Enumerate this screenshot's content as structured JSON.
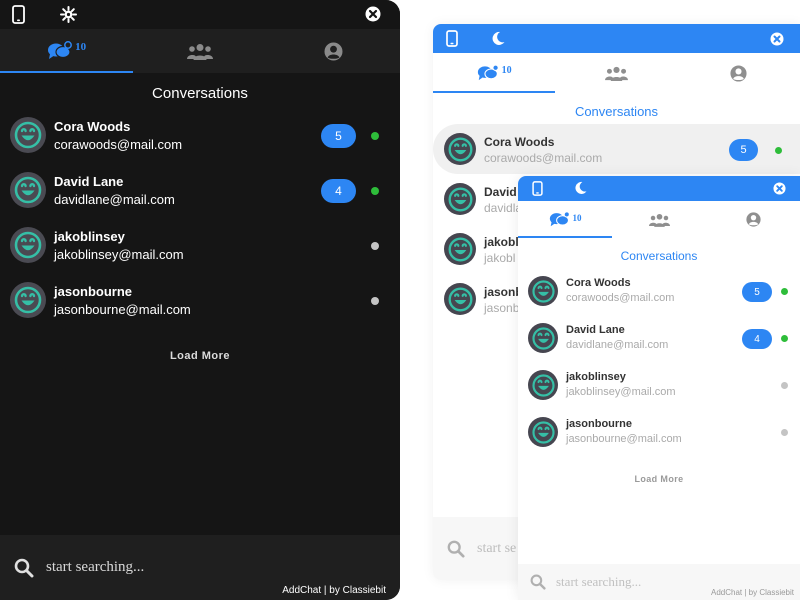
{
  "colors": {
    "accent": "#2d86f3",
    "online": "#2ebd3a",
    "offline": "#c4c4c4",
    "dark_bg": "#151515",
    "smile": "#35bfa6"
  },
  "icons": {
    "phone": "phone-icon",
    "settings": "sun-gear-icon",
    "moon": "moon-icon",
    "close": "close-icon",
    "conversations": "chat-bubbles-icon",
    "groups": "users-group-icon",
    "profile": "user-circle-icon",
    "search": "search-icon",
    "avatar": "smiley-avatar-icon"
  },
  "app": {
    "conversations_count": "10",
    "heading": "Conversations",
    "load_more": "Load More",
    "search_placeholder": "start searching...",
    "credit": "AddChat | by Classiebit"
  },
  "windowB_search_visible": "start se",
  "contacts": [
    {
      "name": "Cora Woods",
      "email": "corawoods@mail.com",
      "unread": "5",
      "online": true
    },
    {
      "name": "David Lane",
      "email": "davidlane@mail.com",
      "unread": "4",
      "online": true
    },
    {
      "name": "jakoblinsey",
      "email": "jakoblinsey@mail.com",
      "unread": "",
      "online": false
    },
    {
      "name": "jasonbourne",
      "email": "jasonbourne@mail.com",
      "unread": "",
      "online": false
    }
  ],
  "windowB_visible_names": [
    "Cora Woods",
    "David",
    "jakobl",
    "jasonb"
  ],
  "windowB_visible_emails": [
    "corawoods@mail.com",
    "davidla",
    "jakobl",
    "jasonb"
  ]
}
